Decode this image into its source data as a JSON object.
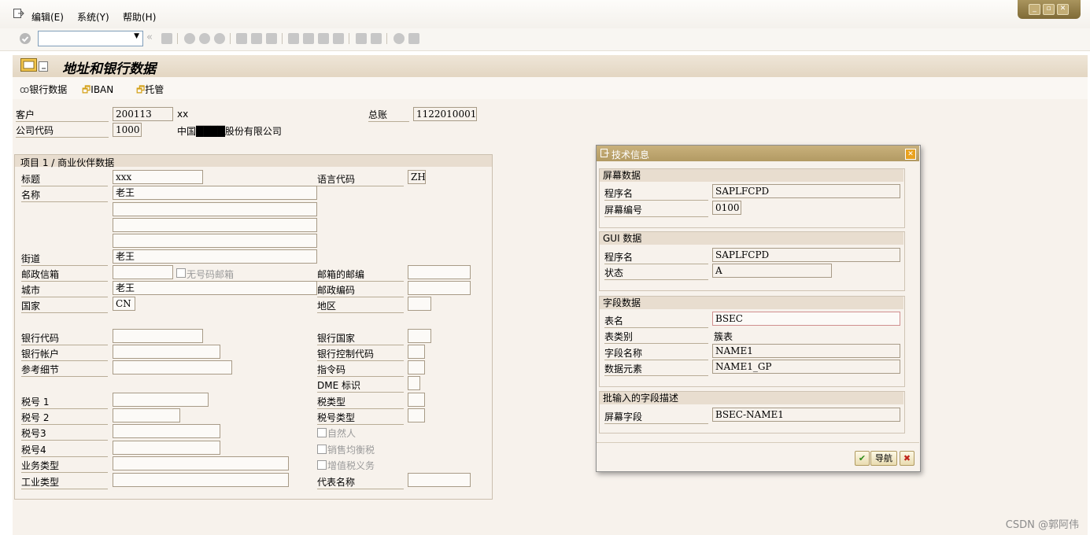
{
  "menu": {
    "edit": "编辑(E)",
    "system": "系统(Y)",
    "help": "帮助(H)"
  },
  "title": "地址和银行数据",
  "appbar": {
    "bank_data": "银行数据",
    "iban": "IBAN",
    "custody": "托管"
  },
  "header": {
    "customer_label": "客户",
    "customer_value": "200113",
    "customer_name": "xx",
    "gl_label": "总账",
    "gl_value": "1122010001",
    "company_label": "公司代码",
    "company_value": "1000",
    "company_name": "中国████股份有限公司"
  },
  "item": {
    "group_title": "项目 1 / 商业伙伴数据",
    "title_label": "标题",
    "title_value": "xxx",
    "language_label": "语言代码",
    "language_value": "ZH",
    "name_label": "名称",
    "name_value": "老王",
    "street_label": "街道",
    "street_value": "老王",
    "pobox_label": "邮政信箱",
    "no_pobox_label": "无号码邮箱",
    "pobox_zip_label": "邮箱的邮编",
    "city_label": "城市",
    "city_value": "老王",
    "postcode_label": "邮政编码",
    "country_label": "国家",
    "country_value": "CN",
    "region_label": "地区",
    "bank_key_label": "银行代码",
    "bank_country_label": "银行国家",
    "bank_account_label": "银行帐户",
    "bank_control_label": "银行控制代码",
    "reference_label": "参考细节",
    "instruction_label": "指令码",
    "dme_label": "DME 标识",
    "tax1_label": "税号 1",
    "tax_type_label": "税类型",
    "tax2_label": "税号 2",
    "tax_number_type_label": "税号类型",
    "tax3_label": "税号3",
    "natural_person_label": "自然人",
    "tax4_label": "税号4",
    "sales_equal_tax_label": "销售均衡税",
    "business_type_label": "业务类型",
    "vat_liable_label": "增值税义务",
    "industry_type_label": "工业类型",
    "rep_name_label": "代表名称"
  },
  "dialog": {
    "title": "技术信息",
    "screen_group": "屏幕数据",
    "program_label": "程序名",
    "program_value": "SAPLFCPD",
    "screen_no_label": "屏幕编号",
    "screen_no_value": "0100",
    "gui_group": "GUI 数据",
    "gui_program_label": "程序名",
    "gui_program_value": "SAPLFCPD",
    "status_label": "状态",
    "status_value": "A",
    "field_group": "字段数据",
    "table_label": "表名",
    "table_value": "BSEC",
    "table_cat_label": "表类别",
    "table_cat_value": "簇表",
    "field_name_label": "字段名称",
    "field_name_value": "NAME1",
    "data_element_label": "数据元素",
    "data_element_value": "NAME1_GP",
    "batch_group": "批输入的字段描述",
    "screen_field_label": "屏幕字段",
    "screen_field_value": "BSEC-NAME1",
    "nav_button": "导航"
  },
  "watermark": "CSDN @郭阿伟"
}
